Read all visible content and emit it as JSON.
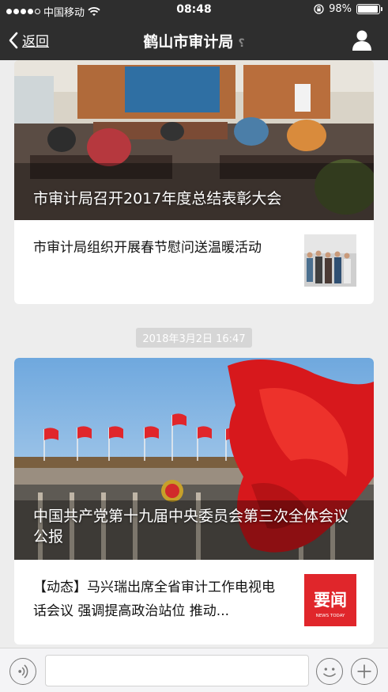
{
  "status_bar": {
    "carrier": "中国移动",
    "time": "08:48",
    "battery": "98%",
    "battery_level": 0.98
  },
  "nav": {
    "back_label": "返回",
    "title": "鹤山市审计局"
  },
  "articles": [
    {
      "hero_title": "市审计局召开2017年度总结表彰大会",
      "sub_title": "市审计局组织开展春节慰问送温暖活动"
    },
    {
      "timestamp": "2018年3月2日 16:47",
      "hero_title": "中国共产党第十九届中央委员会第三次全体会议公报",
      "sub_title": "【动态】马兴瑞出席全省审计工作电视电话会议 强调提高政治站位 推动...",
      "thumb_text": "要闻",
      "thumb_subtext": "NEWS TODAY"
    }
  ],
  "colors": {
    "bar_bg": "#2e2e2e",
    "page_bg": "#ededed",
    "news_red": "#e0262b"
  }
}
